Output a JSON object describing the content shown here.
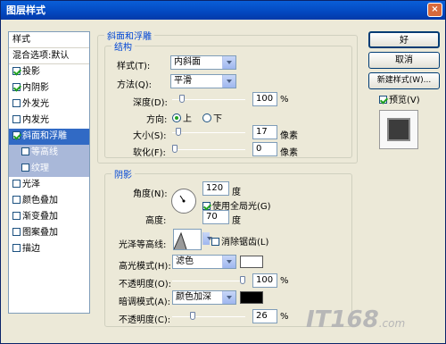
{
  "window": {
    "title": "图层样式",
    "close_glyph": "×"
  },
  "left_panel": {
    "header": "样式",
    "blend": "混合选项:默认",
    "items": [
      {
        "label": "投影",
        "checked": true
      },
      {
        "label": "内阴影",
        "checked": true
      },
      {
        "label": "外发光",
        "checked": false
      },
      {
        "label": "内发光",
        "checked": false
      },
      {
        "label": "斜面和浮雕",
        "checked": true,
        "selected": true
      },
      {
        "label": "等高线",
        "checked": false,
        "sub": true
      },
      {
        "label": "纹理",
        "checked": false,
        "sub": true
      },
      {
        "label": "光泽",
        "checked": false
      },
      {
        "label": "颜色叠加",
        "checked": false
      },
      {
        "label": "渐变叠加",
        "checked": false
      },
      {
        "label": "图案叠加",
        "checked": false
      },
      {
        "label": "描边",
        "checked": false
      }
    ]
  },
  "bevel": {
    "title": "斜面和浮雕",
    "struct_title": "结构",
    "style_label": "样式(T):",
    "style_value": "内斜面",
    "method_label": "方法(Q):",
    "method_value": "平滑",
    "depth_label": "深度(D):",
    "depth_value": "100",
    "depth_unit": "%",
    "depth_pos": 0.1,
    "dir_label": "方向:",
    "dir_up": "上",
    "dir_down": "下",
    "size_label": "大小(S):",
    "size_value": "17",
    "size_unit": "像素",
    "size_pos": 0.05,
    "soften_label": "软化(F):",
    "soften_value": "0",
    "soften_unit": "像素",
    "soften_pos": 0.0
  },
  "shading": {
    "title": "阴影",
    "angle_label": "角度(N):",
    "angle_value": "120",
    "angle_unit": "度",
    "global_light": "使用全局光(G)",
    "altitude_label": "高度:",
    "altitude_value": "70",
    "altitude_unit": "度",
    "gloss_label": "光泽等高线:",
    "antialias": "消除锯齿(L)",
    "hl_label": "高光模式(H):",
    "hl_value": "滤色",
    "hl_color": "#ffffff",
    "hl_op_label": "不透明度(O):",
    "hl_op_value": "100",
    "hl_op_unit": "%",
    "hl_op_pos": 1.0,
    "sh_label": "暗调模式(A):",
    "sh_value": "颜色加深",
    "sh_color": "#000000",
    "sh_op_label": "不透明度(C):",
    "sh_op_value": "26",
    "sh_op_unit": "%",
    "sh_op_pos": 0.26
  },
  "buttons": {
    "ok": "好",
    "cancel": "取消",
    "new_style": "新建样式(W)...",
    "preview": "预览(V)"
  },
  "watermark": {
    "text": "IT168",
    "suffix": ".com"
  }
}
